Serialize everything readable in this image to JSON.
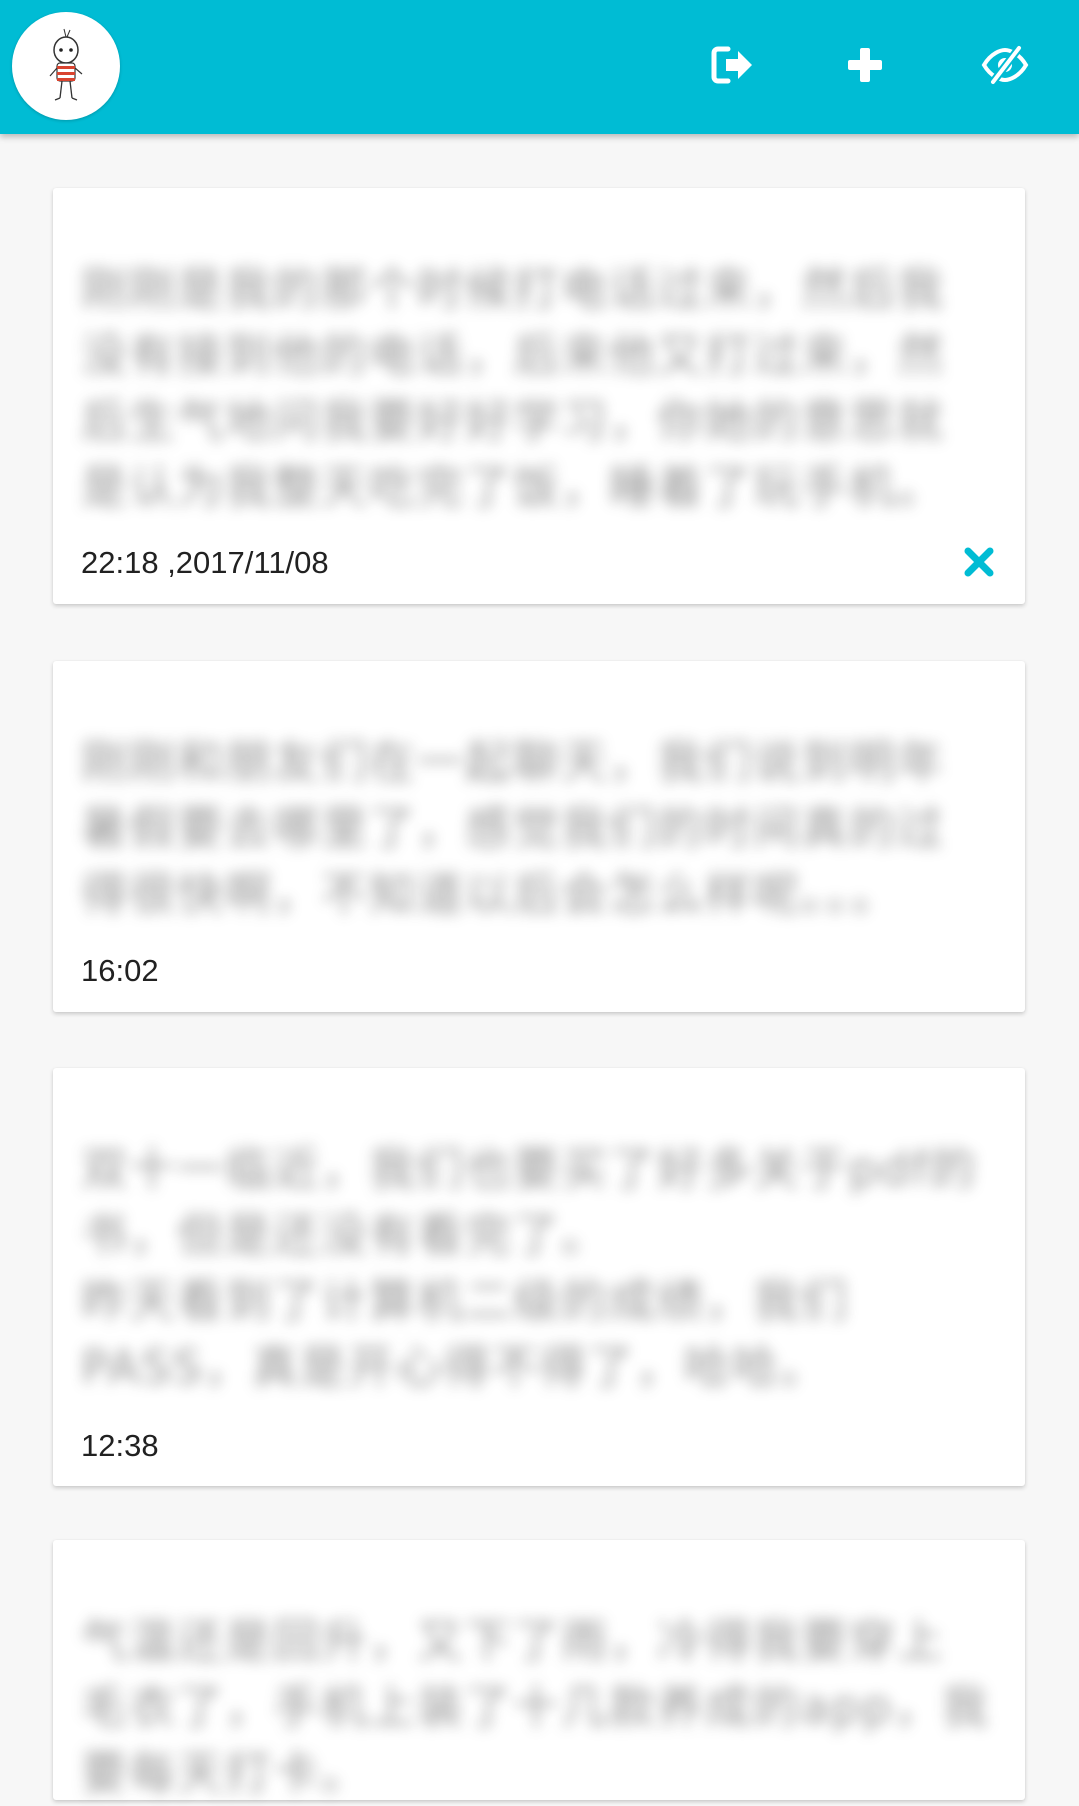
{
  "app_bar": {
    "avatar_icon": "cartoon-figure-avatar",
    "actions": [
      {
        "name": "logout-icon"
      },
      {
        "name": "add-icon"
      },
      {
        "name": "eye-slash-icon"
      }
    ],
    "accent_color": "#00bcd4"
  },
  "entries": [
    {
      "text": "刚刚是我的那个时候打电话过来，然后我没有接到他的电话，后来他又打过来，然后生气地问我要好好学习，你她的意思就是认为我整天吃完了饭，睡着了玩手机。",
      "time": "22:18 ,2017/11/08",
      "has_delete": true
    },
    {
      "text": "刚刚和朋友们在一起聊天，我们说到明年暑假要去哪里了，感觉我们的时间真的过得很快啊，不知道以后会怎么样呢。。。",
      "time": "16:02",
      "has_delete": false
    },
    {
      "text": "双十一临近，我们也要买了好多关于pdf的书，但是还没有看完了。\n昨天看到了计算机二级的成绩，我们PASS，真是开心得不得了，哈哈。",
      "time": "12:38",
      "has_delete": false
    },
    {
      "text": "气温还是回升，又下了雨，冷得我要穿上毛衣了，手机上装了十几款养成的app，我要每天打卡。",
      "time": "",
      "has_delete": false
    }
  ],
  "colors": {
    "delete_icon": "#00bcd4",
    "background": "#f7f7f7"
  }
}
